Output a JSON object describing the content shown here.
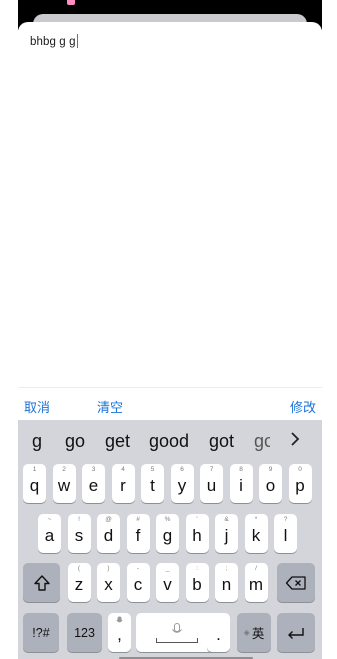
{
  "text_input": {
    "value": "bhbg g g"
  },
  "action_bar": {
    "cancel": "取消",
    "clear": "清空",
    "edit": "修改"
  },
  "suggestions": [
    "g",
    "go",
    "get",
    "good",
    "got",
    "gc"
  ],
  "keyboard": {
    "row1": [
      {
        "key": "q",
        "hint": "1"
      },
      {
        "key": "w",
        "hint": "2"
      },
      {
        "key": "e",
        "hint": "3"
      },
      {
        "key": "r",
        "hint": "4"
      },
      {
        "key": "t",
        "hint": "5"
      },
      {
        "key": "y",
        "hint": "6"
      },
      {
        "key": "u",
        "hint": "7"
      },
      {
        "key": "i",
        "hint": "8"
      },
      {
        "key": "o",
        "hint": "9"
      },
      {
        "key": "p",
        "hint": "0"
      }
    ],
    "row2": [
      {
        "key": "a",
        "hint": "~"
      },
      {
        "key": "s",
        "hint": "!"
      },
      {
        "key": "d",
        "hint": "@"
      },
      {
        "key": "f",
        "hint": "#"
      },
      {
        "key": "g",
        "hint": "%"
      },
      {
        "key": "h",
        "hint": "'"
      },
      {
        "key": "j",
        "hint": "&"
      },
      {
        "key": "k",
        "hint": "*"
      },
      {
        "key": "l",
        "hint": "?"
      }
    ],
    "row3": [
      {
        "key": "z",
        "hint": "("
      },
      {
        "key": "x",
        "hint": ")"
      },
      {
        "key": "c",
        "hint": "-"
      },
      {
        "key": "v",
        "hint": "_"
      },
      {
        "key": "b",
        "hint": ":"
      },
      {
        "key": "n",
        "hint": ";"
      },
      {
        "key": "m",
        "hint": "/"
      }
    ],
    "symbols_label": "!?#",
    "numbers_label": "123",
    "comma": ",",
    "period": ".",
    "language_label": "英"
  },
  "icons": {
    "shift": "shift-arrow-icon",
    "backspace": "backspace-icon",
    "mic": "microphone-icon",
    "return": "return-icon",
    "more": "chevron-right-icon"
  },
  "colors": {
    "accent": "#1a73d9",
    "keyboard_bg": "#d3d5db",
    "dark_key": "#adb1bb"
  }
}
